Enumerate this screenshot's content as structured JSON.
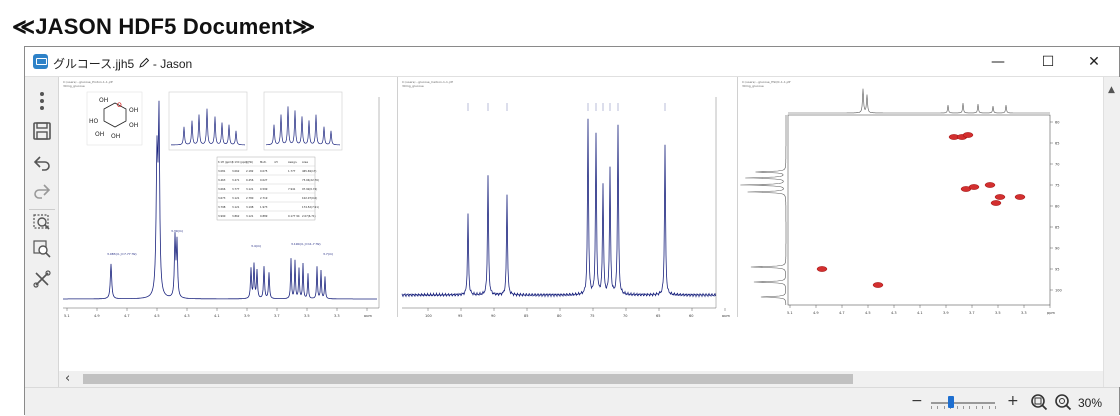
{
  "banner": {
    "text": "≪JASON HDF5 Document≫"
  },
  "window": {
    "title": "グルコース.jjh5",
    "subtitle": "- Jason",
    "controls": {
      "minimize": "—",
      "maximize": "☐",
      "close": "✕"
    }
  },
  "toolbar": {
    "items": [
      {
        "name": "more-icon"
      },
      {
        "name": "save-icon"
      },
      {
        "name": "undo-icon"
      },
      {
        "name": "redo-icon"
      },
      {
        "name": "zoom-fit-icon"
      },
      {
        "name": "zoom-region-icon"
      },
      {
        "name": "tools-icon"
      }
    ]
  },
  "statusbar": {
    "minus": "−",
    "plus": "+",
    "zoom_level": "30%",
    "zoom_fraction": 0.3
  },
  "molecule": {
    "labels": [
      "OH",
      "OH",
      "OH",
      "OH",
      "OH",
      "HO",
      "O"
    ]
  },
  "nmr_table": {
    "headers": [
      "δ 1H (ppm)",
      "δ 13C (ppm)",
      "J (Hz)",
      "Mult.",
      "nH",
      "Assign.",
      "Area"
    ],
    "rows": [
      [
        "3.081",
        "3.062",
        "2.182",
        "0.075",
        "",
        "1.777",
        "465.69(17)"
      ],
      [
        "3.463",
        "3.471",
        "0.456",
        "0.027",
        "",
        "",
        "73.04(22.76)"
      ],
      [
        "3.666",
        "3.777",
        "3.121",
        "0.599",
        "",
        "7.941",
        "97.92(0.74)"
      ],
      [
        "3.673",
        "3.121",
        "2.780",
        "2.719",
        "",
        "",
        "102.07(0.0)"
      ],
      [
        "3.798",
        "3.121",
        "3.198",
        "1.973",
        "",
        "",
        "174.52(7.91)"
      ],
      [
        "3.990",
        "3.862",
        "3.121",
        "0.889",
        "",
        "0.177 94",
        "2.07(6.71)"
      ]
    ]
  },
  "spectra": {
    "proton_peak_labels": [
      "3.083(d, J=7.77 Hz)",
      "3.39(m)",
      "3.4(m)",
      "3.190(d, J=11.7 Hz)",
      "3.7(m)"
    ],
    "proton_xticks": [
      "5.1",
      "4.9",
      "4.7",
      "4.5",
      "4.3",
      "4.1",
      "3.9",
      "3.7",
      "3.5",
      "3.3",
      "ppm"
    ],
    "carbon_xticks": [
      "100",
      "95",
      "90",
      "85",
      "80",
      "75",
      "70",
      "65",
      "60",
      "ppm"
    ],
    "hsqc_xticks": [
      "5.1",
      "4.9",
      "4.7",
      "4.5",
      "4.3",
      "4.1",
      "3.9",
      "3.7",
      "3.5",
      "3.3",
      "ppm"
    ],
    "hsqc_yticks": [
      "60",
      "65",
      "70",
      "75",
      "80",
      "85",
      "90",
      "95",
      "100"
    ]
  }
}
